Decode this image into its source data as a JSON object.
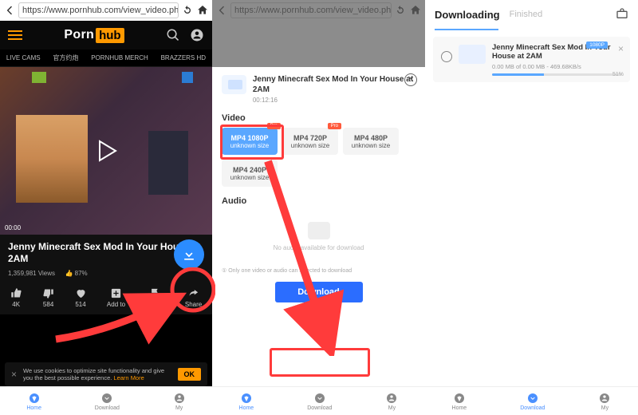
{
  "url": "https://www.pornhub.com/view_video.php?vi",
  "logo": {
    "p": "Porn",
    "hub": "hub"
  },
  "nav": [
    "LIVE CAMS",
    "官方约炮",
    "PORNHUB MERCH",
    "BRAZZERS HD"
  ],
  "video": {
    "title": "Jenny Minecraft Sex Mod In Your House at 2AM",
    "views": "1,359,981 Views",
    "like_pct": "87%",
    "time_elapsed": "00:00",
    "duration": "00:12:16"
  },
  "actions": {
    "like_count": "4K",
    "dislike_count": "584",
    "fav_count": "514",
    "addto": "Add to",
    "report": "Report",
    "share": "Share"
  },
  "cookie": {
    "text": "We use cookies to optimize site functionality and give you the best possible experience. ",
    "learn_more": "Learn More",
    "ok": "OK"
  },
  "bottom_nav": [
    "Home",
    "Download",
    "My"
  ],
  "sheet": {
    "title": "Jenny Minecraft Sex Mod In Your House at 2AM",
    "section_video": "Video",
    "section_audio": "Audio",
    "options": [
      {
        "q": "MP4 1080P",
        "s": "unknown size",
        "pro": true,
        "sel": true
      },
      {
        "q": "MP4 720P",
        "s": "unknown size",
        "pro": true
      },
      {
        "q": "MP4 480P",
        "s": "unknown size"
      },
      {
        "q": "MP4 240P",
        "s": "unknown size"
      }
    ],
    "pro_label": "Pro",
    "audio_empty": "No audio available for download",
    "note": "① Only one video or audio can selected to download",
    "download": "Download"
  },
  "p3": {
    "tab_downloading": "Downloading",
    "tab_finished": "Finished",
    "item_title": "Jenny Minecraft Sex Mod In Your House at 2AM",
    "size": "0.00 MB of 0.00 MB - 469.68KB/s",
    "tag": "1080P",
    "pct": "51%"
  }
}
